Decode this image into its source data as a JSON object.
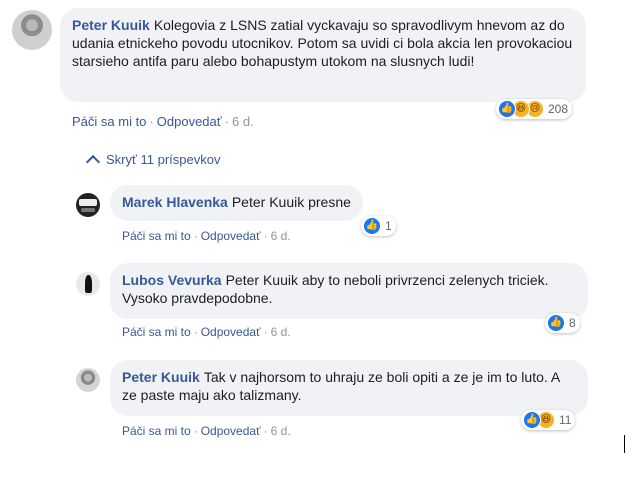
{
  "comments": [
    {
      "author": "Peter Kuuik",
      "text": "Kolegovia z LSNS zatial vyckavaju so spravodlivym hnevom az do udania etnickeho povodu utocnikov. Potom sa uvidi ci bola akcia len provokaciou starsieho antifa paru alebo bohapustym utokom na slusnych ludi!",
      "like_label": "Páči sa mi to",
      "reply_label": "Odpovedať",
      "time": "6 d.",
      "reaction_icons": [
        "like-icon",
        "haha-icon",
        "sad-icon"
      ],
      "reaction_count": "208"
    }
  ],
  "toggle": {
    "label": "Skryť 11 príspevkov"
  },
  "replies": [
    {
      "author": "Marek Hlavenka",
      "text": "Peter Kuuik presne",
      "like_label": "Páči sa mi to",
      "reply_label": "Odpovedať",
      "time": "6 d.",
      "reaction_icons": [
        "like-icon"
      ],
      "reaction_count": "1"
    },
    {
      "author": "Lubos Vevurka",
      "text": "Peter Kuuik aby to neboli privrzenci zelenych triciek. Vysoko pravdepodobne.",
      "like_label": "Páči sa mi to",
      "reply_label": "Odpovedať",
      "time": "6 d.",
      "reaction_icons": [
        "like-icon"
      ],
      "reaction_count": "8"
    },
    {
      "author": "Peter Kuuik",
      "text": "Tak v najhorsom to uhraju ze boli opiti a ze je im to luto. A ze paste maju ako talizmany.",
      "like_label": "Páči sa mi to",
      "reply_label": "Odpovedať",
      "time": "6 d.",
      "reaction_icons": [
        "like-icon",
        "haha-icon"
      ],
      "reaction_count": "11"
    }
  ],
  "colors": {
    "link": "#385898",
    "bubble": "#f0f2f5",
    "like": "#1877f2",
    "haha": "#f7b125"
  }
}
